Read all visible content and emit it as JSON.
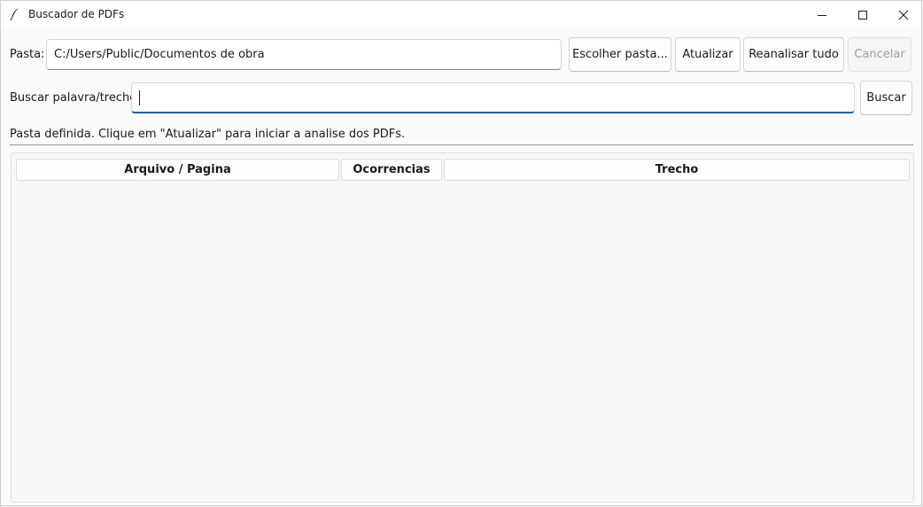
{
  "window": {
    "title": "Buscador de PDFs",
    "icon": "feather-icon",
    "controls": [
      "minimize-icon",
      "maximize-icon",
      "close-icon"
    ]
  },
  "folder": {
    "label": "Pasta:",
    "value": "C:/Users/Public/Documentos de obra"
  },
  "toolbar": {
    "choose_folder": "Escolher pasta...",
    "refresh": "Atualizar",
    "reanalyze": "Reanalisar tudo",
    "cancel": "Cancelar"
  },
  "search": {
    "label": "Buscar palavra/trecho:",
    "value": "",
    "button": "Buscar"
  },
  "status": {
    "text": "Pasta definida. Clique em \"Atualizar\" para iniciar a analise dos PDFs."
  },
  "results": {
    "columns": [
      "Arquivo / Pagina",
      "Ocorrencias",
      "Trecho"
    ],
    "rows": []
  },
  "colors": {
    "accent": "#005fb8",
    "disabled_text": "#9d9d9d"
  }
}
